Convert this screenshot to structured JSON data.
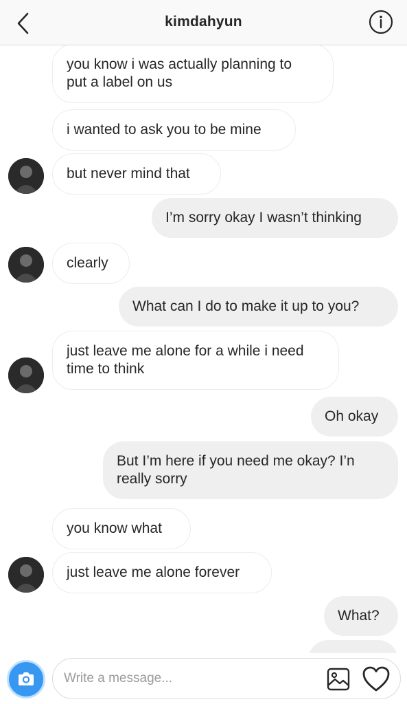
{
  "header": {
    "username": "kimdahyun"
  },
  "icons": {
    "back": "chevron-left-icon",
    "info": "info-icon",
    "camera": "camera-icon",
    "gallery": "image-icon",
    "heart": "heart-icon"
  },
  "messages": [
    {
      "direction": "incoming",
      "text_lines": [
        "you know i was actually planning to",
        "put a label on us"
      ],
      "avatar": false
    },
    {
      "direction": "incoming",
      "text_lines": [
        "i wanted to ask you to be mine"
      ],
      "avatar": false
    },
    {
      "direction": "incoming",
      "text_lines": [
        "but never mind that"
      ],
      "avatar": true
    },
    {
      "direction": "outgoing",
      "text_lines": [
        "I’m sorry okay I wasn’t thinking"
      ]
    },
    {
      "direction": "incoming",
      "text_lines": [
        "clearly"
      ],
      "avatar": true
    },
    {
      "direction": "outgoing",
      "text_lines": [
        "What can I do to make it up to you?"
      ]
    },
    {
      "direction": "incoming",
      "text_lines": [
        "just leave me alone for a while i need",
        "time to think"
      ],
      "avatar": true
    },
    {
      "direction": "outgoing",
      "text_lines": [
        "Oh okay"
      ]
    },
    {
      "direction": "outgoing",
      "text_lines": [
        "But I’m here if you need me okay? I’n",
        "really sorry"
      ]
    },
    {
      "direction": "incoming",
      "text_lines": [
        "you know what"
      ],
      "avatar": false
    },
    {
      "direction": "incoming",
      "text_lines": [
        "just leave me alone forever"
      ],
      "avatar": true
    },
    {
      "direction": "outgoing",
      "text_lines": [
        "What?"
      ]
    }
  ],
  "composer": {
    "placeholder": "Write a message..."
  },
  "colors": {
    "accent": "#3897f0",
    "outgoing_bubble": "#efefef",
    "incoming_border": "#ececec"
  }
}
